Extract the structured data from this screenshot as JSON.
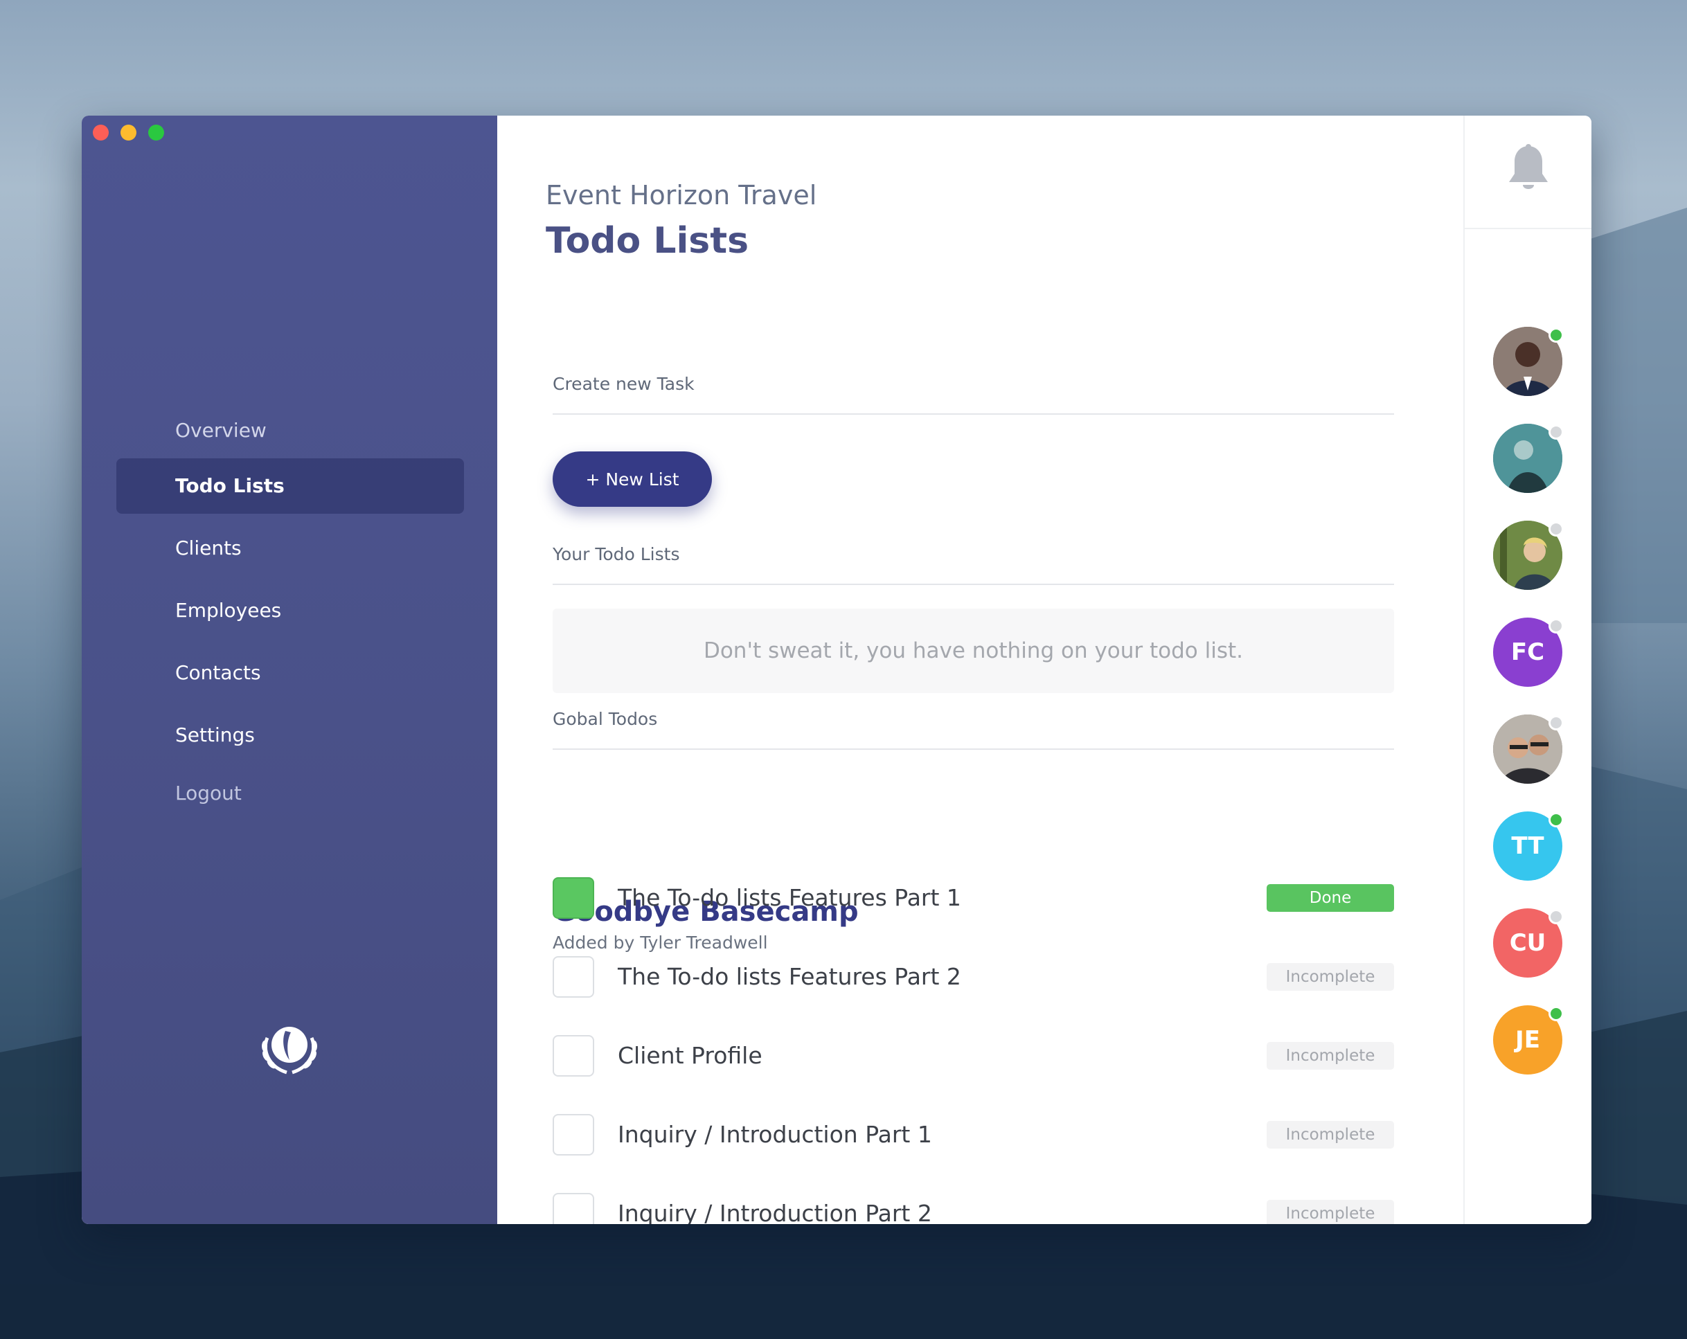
{
  "window": {
    "title": "Event Horizon Travel"
  },
  "sidebar": {
    "items": [
      {
        "label": "Overview",
        "active": false
      },
      {
        "label": "Todo Lists",
        "active": true
      },
      {
        "label": "Clients",
        "active": false
      },
      {
        "label": "Employees",
        "active": false
      },
      {
        "label": "Contacts",
        "active": false
      },
      {
        "label": "Settings",
        "active": false
      },
      {
        "label": "Logout",
        "active": false
      }
    ],
    "logo_icon": "laurel-wreath-logo-icon"
  },
  "header": {
    "company": "Event Horizon Travel",
    "title": "Todo Lists"
  },
  "create_task": {
    "label": "Create new Task",
    "new_list_button": "+ New List"
  },
  "your_lists": {
    "label": "Your Todo Lists",
    "empty_message": "Don't sweat it, you have nothing on your todo list."
  },
  "global_todos": {
    "label": "Gobal Todos",
    "list": {
      "title": "Goodbye Basecamp",
      "added_by": "Added by Tyler Treadwell",
      "items": [
        {
          "text": "The To-do lists Features Part 1",
          "status": "Done",
          "checked": true
        },
        {
          "text": "The To-do lists Features Part 2",
          "status": "Incomplete",
          "checked": false
        },
        {
          "text": "Client Profile",
          "status": "Incomplete",
          "checked": false
        },
        {
          "text": "Inquiry / Introduction Part 1",
          "status": "Incomplete",
          "checked": false
        },
        {
          "text": "Inquiry / Introduction Part 2",
          "status": "Incomplete",
          "checked": false
        }
      ]
    }
  },
  "right_panel": {
    "bell_icon": "bell-icon",
    "users": [
      {
        "initials": "",
        "photo": true,
        "online": true
      },
      {
        "initials": "",
        "photo": true,
        "online": false
      },
      {
        "initials": "",
        "photo": true,
        "online": false
      },
      {
        "initials": "FC",
        "color": "#8a3fd0",
        "online": false
      },
      {
        "initials": "",
        "photo": true,
        "online": false
      },
      {
        "initials": "TT",
        "color": "#36c6ee",
        "online": true
      },
      {
        "initials": "CU",
        "color": "#f26565",
        "online": false
      },
      {
        "initials": "JE",
        "color": "#f8a229",
        "online": true
      }
    ]
  },
  "colors": {
    "sidebar": "#4a5189",
    "accent": "#353a86",
    "done": "#59c460",
    "online": "#3fbf4a"
  }
}
